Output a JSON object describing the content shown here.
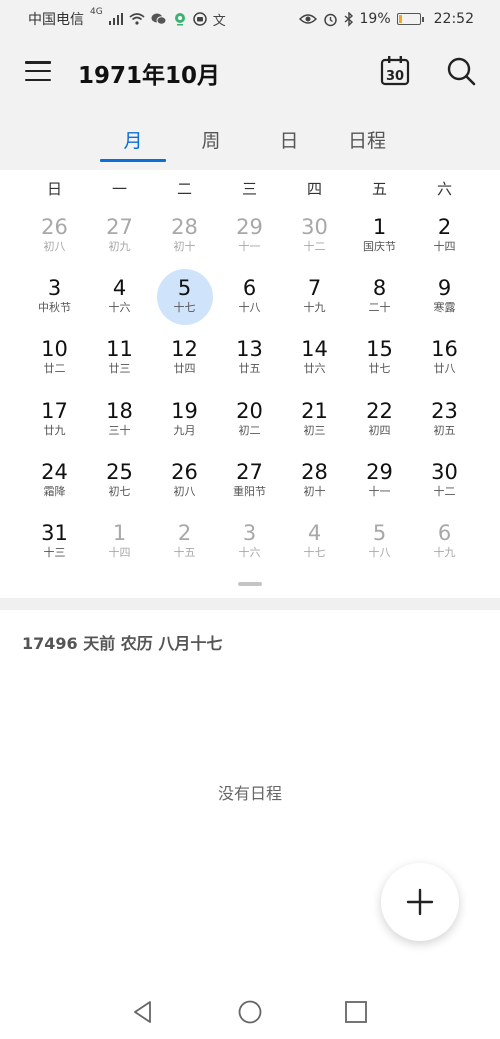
{
  "status_bar": {
    "carrier": "中国电信",
    "network": "4G",
    "battery_percent": "19%",
    "time": "22:52",
    "icons": [
      "signal-icon",
      "wifi-icon",
      "wechat-icon",
      "location-icon",
      "camera-icon",
      "text-icon",
      "eye-icon",
      "alarm-icon",
      "bluetooth-icon",
      "battery-icon"
    ]
  },
  "app_bar": {
    "title": "1971年10月",
    "today_number": "30"
  },
  "tabs": [
    {
      "label": "月",
      "active": true
    },
    {
      "label": "周",
      "active": false
    },
    {
      "label": "日",
      "active": false
    },
    {
      "label": "日程",
      "active": false
    }
  ],
  "weekdays": [
    "日",
    "一",
    "二",
    "三",
    "四",
    "五",
    "六"
  ],
  "weeks": [
    [
      {
        "num": "26",
        "lunar": "初八",
        "other": true
      },
      {
        "num": "27",
        "lunar": "初九",
        "other": true
      },
      {
        "num": "28",
        "lunar": "初十",
        "other": true
      },
      {
        "num": "29",
        "lunar": "十一",
        "other": true
      },
      {
        "num": "30",
        "lunar": "十二",
        "other": true
      },
      {
        "num": "1",
        "lunar": "国庆节",
        "other": false
      },
      {
        "num": "2",
        "lunar": "十四",
        "other": false
      }
    ],
    [
      {
        "num": "3",
        "lunar": "中秋节",
        "other": false
      },
      {
        "num": "4",
        "lunar": "十六",
        "other": false
      },
      {
        "num": "5",
        "lunar": "十七",
        "other": false,
        "selected": true
      },
      {
        "num": "6",
        "lunar": "十八",
        "other": false
      },
      {
        "num": "7",
        "lunar": "十九",
        "other": false
      },
      {
        "num": "8",
        "lunar": "二十",
        "other": false
      },
      {
        "num": "9",
        "lunar": "寒露",
        "other": false
      }
    ],
    [
      {
        "num": "10",
        "lunar": "廿二",
        "other": false
      },
      {
        "num": "11",
        "lunar": "廿三",
        "other": false
      },
      {
        "num": "12",
        "lunar": "廿四",
        "other": false
      },
      {
        "num": "13",
        "lunar": "廿五",
        "other": false
      },
      {
        "num": "14",
        "lunar": "廿六",
        "other": false
      },
      {
        "num": "15",
        "lunar": "廿七",
        "other": false
      },
      {
        "num": "16",
        "lunar": "廿八",
        "other": false
      }
    ],
    [
      {
        "num": "17",
        "lunar": "廿九",
        "other": false
      },
      {
        "num": "18",
        "lunar": "三十",
        "other": false
      },
      {
        "num": "19",
        "lunar": "九月",
        "other": false
      },
      {
        "num": "20",
        "lunar": "初二",
        "other": false
      },
      {
        "num": "21",
        "lunar": "初三",
        "other": false
      },
      {
        "num": "22",
        "lunar": "初四",
        "other": false
      },
      {
        "num": "23",
        "lunar": "初五",
        "other": false
      }
    ],
    [
      {
        "num": "24",
        "lunar": "霜降",
        "other": false
      },
      {
        "num": "25",
        "lunar": "初七",
        "other": false
      },
      {
        "num": "26",
        "lunar": "初八",
        "other": false
      },
      {
        "num": "27",
        "lunar": "重阳节",
        "other": false
      },
      {
        "num": "28",
        "lunar": "初十",
        "other": false
      },
      {
        "num": "29",
        "lunar": "十一",
        "other": false
      },
      {
        "num": "30",
        "lunar": "十二",
        "other": false
      }
    ],
    [
      {
        "num": "31",
        "lunar": "十三",
        "other": false
      },
      {
        "num": "1",
        "lunar": "十四",
        "other": true
      },
      {
        "num": "2",
        "lunar": "十五",
        "other": true
      },
      {
        "num": "3",
        "lunar": "十六",
        "other": true
      },
      {
        "num": "4",
        "lunar": "十七",
        "other": true
      },
      {
        "num": "5",
        "lunar": "十八",
        "other": true
      },
      {
        "num": "6",
        "lunar": "十九",
        "other": true
      }
    ]
  ],
  "detail": {
    "info": "17496 天前  农历 八月十七",
    "empty_text": "没有日程"
  },
  "colors": {
    "accent": "#0a6fd6",
    "selected_bg": "#cfe4fb",
    "header_bg": "#f2f2f2",
    "battery": "#f5a623"
  }
}
